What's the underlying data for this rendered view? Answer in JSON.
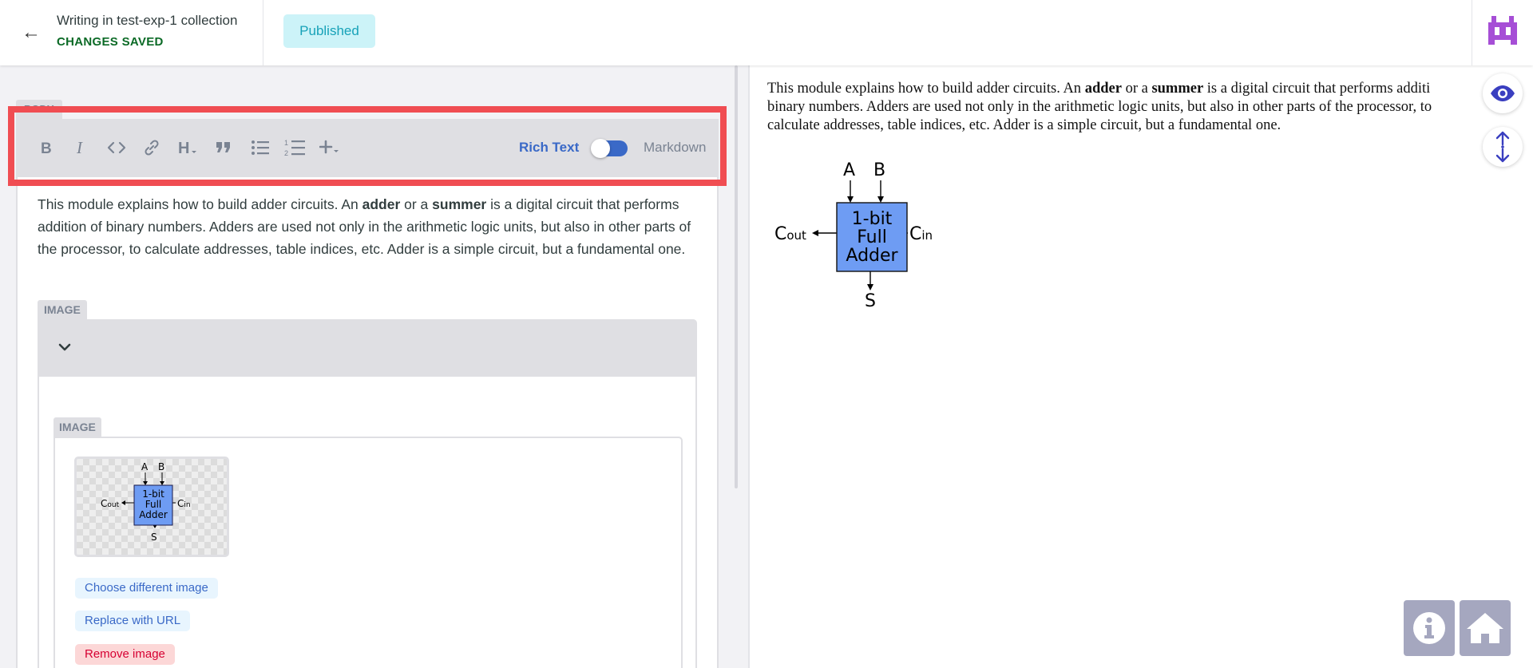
{
  "header": {
    "title": "Writing in test-exp-1 collection",
    "save_state": "CHANGES SAVED",
    "status_badge": "Published",
    "back_icon": "arrow-left-icon",
    "avatar_icon": "pixel-robot-avatar"
  },
  "editor": {
    "field_label": "BODY",
    "toolbar": {
      "buttons": [
        "bold-icon",
        "italic-icon",
        "code-icon",
        "link-icon",
        "heading-icon",
        "quote-icon",
        "bulleted-list-icon",
        "numbered-list-icon",
        "add-component-icon"
      ],
      "mode_rich": "Rich Text",
      "mode_markdown": "Markdown",
      "mode_selected": "Rich Text"
    },
    "body": {
      "t1": "This module explains how to build adder circuits. An ",
      "b1": "adder",
      "t2": " or a ",
      "b2": "summer",
      "t3": " is a digital circuit that performs addition of binary numbers. Adders are used not only in the arithmetic logic units, but also in other parts of the processor, to calculate addresses, table indices, etc. Adder is a simple circuit, but a fundamental one."
    },
    "image_widget": {
      "label": "IMAGE",
      "collapse_icon": "chevron-down-icon",
      "inner_label": "IMAGE",
      "choose_label": "Choose different image",
      "replace_label": "Replace with URL",
      "remove_label": "Remove image"
    }
  },
  "diagram": {
    "a": "A",
    "b": "B",
    "box_line1": "1-bit",
    "box_line2": "Full",
    "box_line3": "Adder",
    "cout_main": "C",
    "cout_sub": "out",
    "cin_main": "C",
    "cin_sub": "in",
    "s": "S",
    "box_color": "#6e9cf3"
  },
  "preview": {
    "line1_pre": "This module explains how to build adder circuits. An ",
    "line1_b1": "adder",
    "line1_mid": " or a ",
    "line1_b2": "summer",
    "line1_post": " is a digital circuit that performs additi",
    "line2": "binary numbers. Adders are used not only in the arithmetic logic units, but also in other parts of the processor, to",
    "line3": "calculate addresses, table indices, etc. Adder is a simple circuit, but a fundamental one."
  },
  "side_controls": [
    "eye-icon",
    "sync-scroll-icon"
  ],
  "footer_controls": [
    "info-icon",
    "home-icon"
  ],
  "colors": {
    "accent": "#3a69c7",
    "highlight": "#f04d52",
    "saved": "#0b6a26",
    "badge_bg": "#ccf3f8",
    "badge_fg": "#17a2b8",
    "avatar": "#a64ed6"
  }
}
